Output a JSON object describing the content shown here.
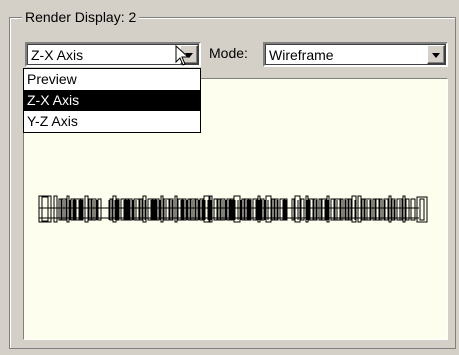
{
  "group": {
    "title": "Render Display: 2"
  },
  "axis_combo": {
    "selected": "Z-X Axis",
    "options": [
      "Preview",
      "Z-X Axis",
      "Y-Z Axis"
    ],
    "highlighted_index": 1
  },
  "mode": {
    "label": "Mode:",
    "selected": "Wireframe"
  },
  "colors": {
    "panel": "#d4d0c8",
    "render_bg": "#fefeef",
    "highlight": "#000000"
  },
  "icons": {
    "combo_arrow": "chevron-down-icon",
    "cursor": "mouse-pointer-icon"
  }
}
